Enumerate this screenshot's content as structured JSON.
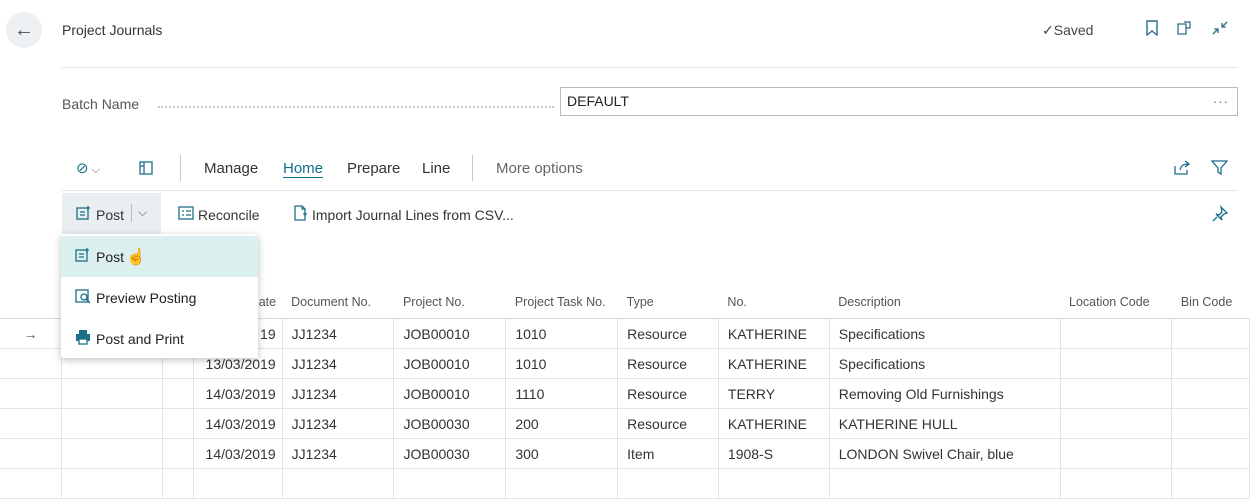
{
  "header": {
    "title": "Project Journals",
    "saved_label": "Saved"
  },
  "batch": {
    "label": "Batch Name",
    "value": "DEFAULT",
    "more": "···"
  },
  "action_bar": {
    "items": [
      "Manage",
      "Home",
      "Prepare",
      "Line",
      "More options"
    ],
    "active": "Home"
  },
  "toolbar": {
    "post_label": "Post",
    "reconcile_label": "Reconcile",
    "import_label": "Import Journal Lines from CSV..."
  },
  "post_menu": {
    "items": [
      {
        "label": "Post",
        "icon": "post-icon"
      },
      {
        "label": "Preview Posting",
        "icon": "preview-posting-icon"
      },
      {
        "label": "Post and Print",
        "icon": "printer-icon"
      }
    ]
  },
  "table": {
    "columns": [
      "",
      "",
      "ate",
      "Document No.",
      "Project No.",
      "Project Task No.",
      "Type",
      "No.",
      "Description",
      "Location Code",
      "Bin Code"
    ],
    "rows": [
      {
        "marker": "→",
        "date": "19",
        "doc": "JJ1234",
        "project": "JOB00010",
        "task": "1010",
        "type": "Resource",
        "no": "KATHERINE",
        "desc": "Specifications",
        "loc": "",
        "bin": ""
      },
      {
        "marker": "",
        "date": "13/03/2019",
        "doc": "JJ1234",
        "project": "JOB00010",
        "task": "1010",
        "type": "Resource",
        "no": "KATHERINE",
        "desc": "Specifications",
        "loc": "",
        "bin": ""
      },
      {
        "marker": "",
        "date": "14/03/2019",
        "doc": "JJ1234",
        "project": "JOB00010",
        "task": "1110",
        "type": "Resource",
        "no": "TERRY",
        "desc": "Removing Old Furnishings",
        "loc": "",
        "bin": ""
      },
      {
        "marker": "",
        "date": "14/03/2019",
        "doc": "JJ1234",
        "project": "JOB00030",
        "task": "200",
        "type": "Resource",
        "no": "KATHERINE",
        "desc": "KATHERINE HULL",
        "loc": "",
        "bin": ""
      },
      {
        "marker": "",
        "date": "14/03/2019",
        "doc": "JJ1234",
        "project": "JOB00030",
        "task": "300",
        "type": "Item",
        "no": "1908-S",
        "desc": "LONDON Swivel Chair, blue",
        "loc": "",
        "bin": ""
      },
      {
        "marker": "",
        "date": "",
        "doc": "",
        "project": "",
        "task": "",
        "type": "",
        "no": "",
        "desc": "",
        "loc": "",
        "bin": ""
      }
    ]
  }
}
